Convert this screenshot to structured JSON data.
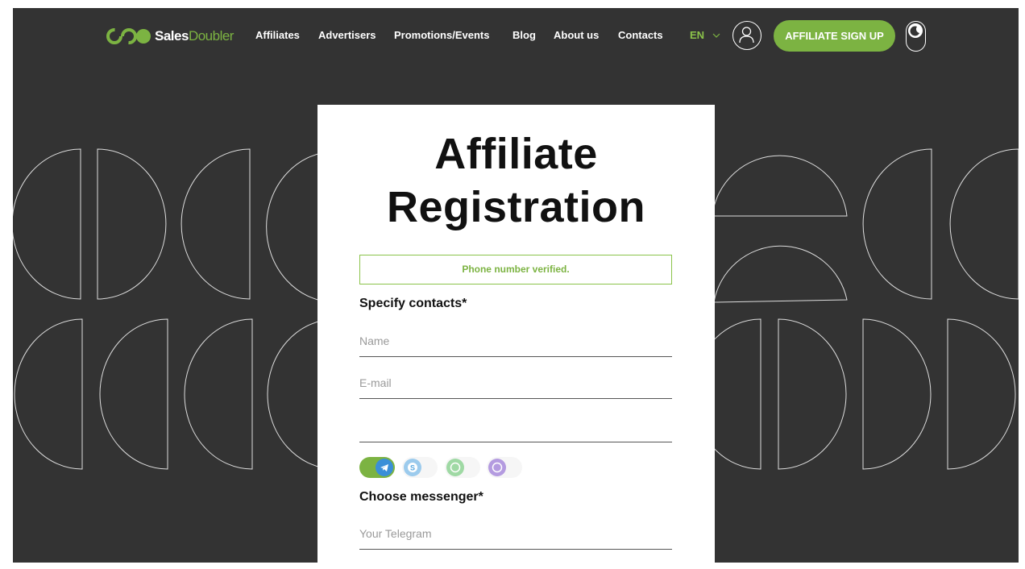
{
  "brand": {
    "name_part1": "Sales",
    "name_part2": "Doubler",
    "accent_color": "#7cb342"
  },
  "nav": {
    "items": [
      {
        "label": "Affiliates"
      },
      {
        "label": "Advertisers"
      },
      {
        "label": "Promotions/Events"
      },
      {
        "label": "Blog"
      },
      {
        "label": "About us"
      },
      {
        "label": "Contacts"
      }
    ],
    "language": "EN",
    "signup_label": "AFFILIATE SIGN UP",
    "user_icon": "user-icon",
    "theme_icon": "moon-icon"
  },
  "form": {
    "title_line1": "Affiliate",
    "title_line2": "Registration",
    "verified_message": "Phone number verified.",
    "contacts_label": "Specify contacts*",
    "name_placeholder": "Name",
    "email_placeholder": "E-mail",
    "phone_value": "",
    "messenger_label": "Choose messenger*",
    "messenger_placeholder": "Your Telegram",
    "messengers": [
      {
        "name": "telegram",
        "icon": "telegram-icon",
        "color": "#3a8fd8",
        "selected": true
      },
      {
        "name": "skype",
        "icon": "skype-icon",
        "color": "#9ccbed",
        "selected": false
      },
      {
        "name": "whatsapp",
        "icon": "whatsapp-icon",
        "color": "#9fd9a4",
        "selected": false
      },
      {
        "name": "viber",
        "icon": "viber-icon",
        "color": "#b49be0",
        "selected": false
      }
    ]
  }
}
